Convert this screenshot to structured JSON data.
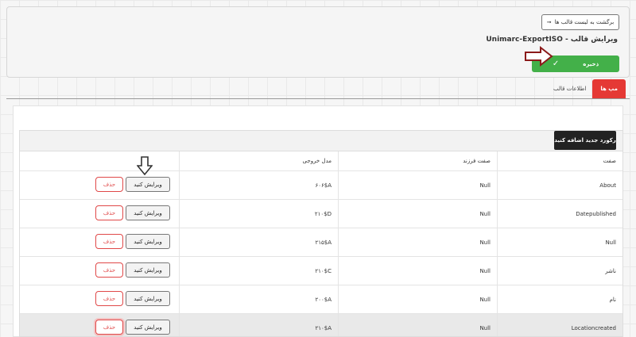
{
  "header": {
    "back_label": "برگشت به لیست قالب ها",
    "title": "ویرایش قالب - Unimarc-ExportISO",
    "save_label": "ذخیره"
  },
  "tabs": [
    {
      "label": "مپ ها",
      "active": true
    },
    {
      "label": "اطلاعات قالب",
      "active": false
    }
  ],
  "table": {
    "add_label": "رکورد جدید اضافه کنید",
    "columns": {
      "property": "صفت",
      "child": "صفت فرزند",
      "output": "مدل خروجی"
    },
    "edit_label": "ویرایش کنید",
    "delete_label": "حذف",
    "rows": [
      {
        "property": "About",
        "child": "Null",
        "output": "۶۰۶$A"
      },
      {
        "property": "Datepublished",
        "child": "Null",
        "output": "۲۱۰$D"
      },
      {
        "property": "Null",
        "child": "Null",
        "output": "۲۱۵$A"
      },
      {
        "property": "ناشر",
        "child": "Null",
        "output": "۲۱۰$C"
      },
      {
        "property": "نام",
        "child": "Null",
        "output": "۲۰۰$A"
      },
      {
        "property": "Locationcreated",
        "child": "Null",
        "output": "۲۱۰$A"
      }
    ]
  },
  "colors": {
    "accent_green": "#43b049",
    "accent_red": "#e53935",
    "annotation_arrow": "#8b1a1a"
  }
}
